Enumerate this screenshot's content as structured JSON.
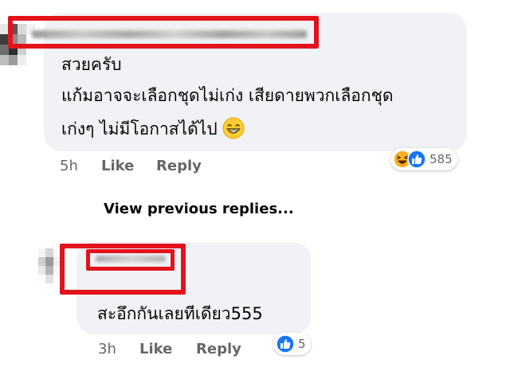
{
  "comment_1": {
    "text_line_1": "สวยครับ",
    "text_line_2": "แก้มอาจจะเลือกชุดไม่เก่ง เสียดายพวกเลือกชุด",
    "text_line_3": "เก่งๆ ไม่มีโอกาสได้ไป",
    "time": "5h",
    "like_label": "Like",
    "reply_label": "Reply",
    "reaction_count": "585",
    "reaction_icons": [
      "haha-icon",
      "like-icon"
    ],
    "inline_emoji": "grinning-face-icon"
  },
  "view_previous_label": "View previous replies...",
  "comment_2": {
    "text": "สะอึกกันเลยทีเดียว555",
    "time": "3h",
    "like_label": "Like",
    "reply_label": "Reply",
    "reaction_count": "5",
    "reaction_icons": [
      "like-icon"
    ]
  },
  "colors": {
    "bubble_bg": "#f0f2f5",
    "highlight_red": "#e3131b",
    "like_blue": "#1877f2",
    "haha_yellow": "#f7b125",
    "meta_gray": "#65676b",
    "text_dark": "#050505"
  }
}
